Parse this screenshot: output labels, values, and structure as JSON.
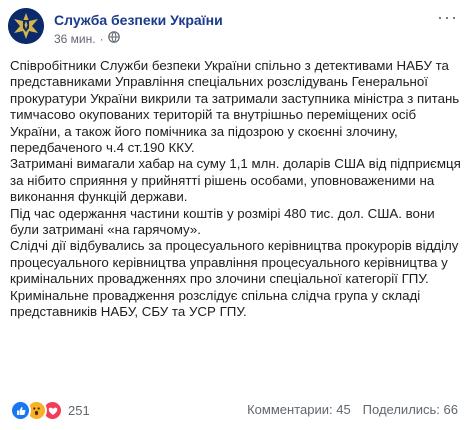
{
  "header": {
    "page_name": "Служба безпеки України",
    "time": "36 мин.",
    "separator": "·",
    "more_label": "···"
  },
  "post": {
    "paragraphs": [
      "Співробітники Служби безпеки України спільно з детективами НАБУ та представниками Управління спеціальних розслідувань Генеральної прокуратури України викрили та затримали заступника міністра з питань тимчасово окупованих територій та внутрішньо переміщених осіб України, а також його помічника за підозрою у скоєнні злочину, передбаченого ч.4 ст.190 ККУ.",
      "Затримані вимагали хабар на суму 1,1 млн. доларів США від підприємця за нібито сприяння у прийнятті рішень особами, уповноваженими на виконання функцій держави.",
      "Під час одержання частини коштів у розмірі 480 тис. дол. США. вони були затримані «на гарячому».",
      "Слідчі дії відбувались за процесуального керівництва прокурорів відділу процесуального керівництва управління процесуального керівництва у кримінальних провадженнях про злочини спеціальної категорії ГПУ.",
      "Кримінальне провадження розслідує спільна слідча група у складі представників НАБУ, СБУ та УСР ГПУ."
    ]
  },
  "footer": {
    "reaction_count": "251",
    "comments": "Комментарии: 45",
    "shares": "Поделились: 66",
    "reactions": [
      "like-icon",
      "wow-icon",
      "love-icon"
    ]
  },
  "colors": {
    "page_name": "#1a3a8c",
    "like": "#1877f2",
    "wow": "#f7b125",
    "love": "#f33e58"
  }
}
